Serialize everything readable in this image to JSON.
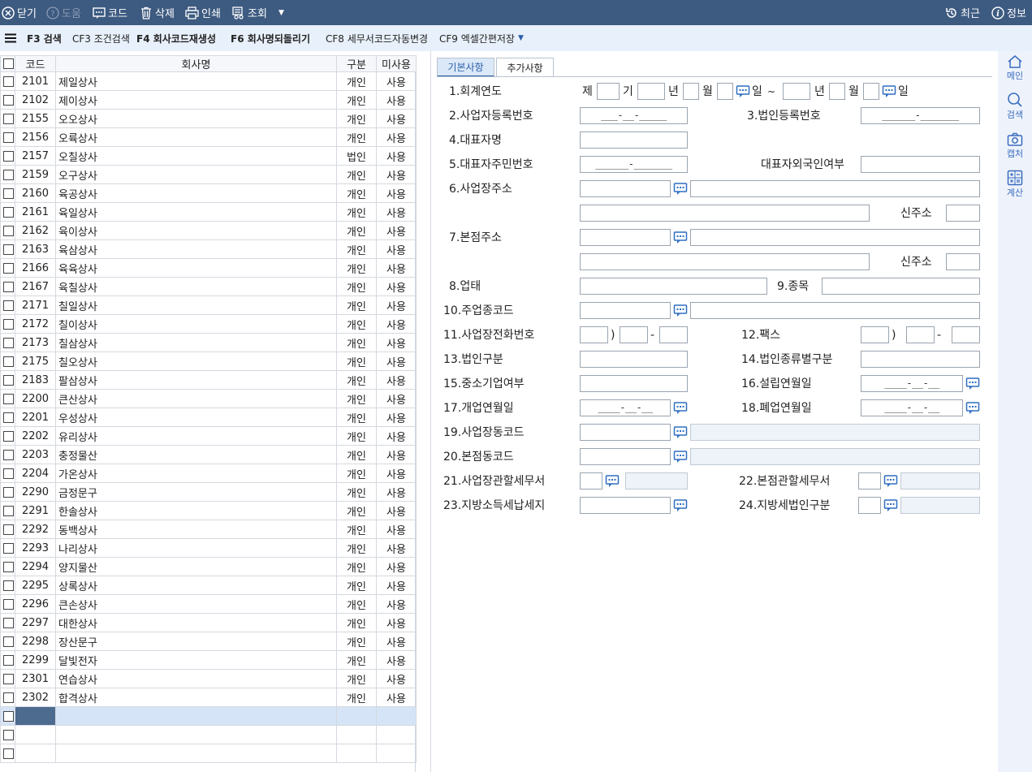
{
  "topbar": {
    "close_label": "닫기",
    "help_label": "도움",
    "code_label": "코드",
    "delete_label": "삭제",
    "print_label": "인쇄",
    "lookup_label": "조회",
    "recent_label": "최근",
    "info_label": "정보"
  },
  "fbar": {
    "f3": "F3 검색",
    "cf3": "CF3 조건검색",
    "f4": "F4 회사코드재생성",
    "f6": "F6 회사명되돌리기",
    "cf8": "CF8 세무서코드자동변경",
    "cf9": "CF9 엑셀간편저장"
  },
  "side": {
    "main": "메인",
    "search": "검색",
    "capture": "캡처",
    "calc": "계산"
  },
  "grid": {
    "headers": [
      "코드",
      "회사명",
      "구분",
      "미사용"
    ],
    "rows": [
      [
        "2101",
        "제일상사",
        "개인",
        "사용"
      ],
      [
        "2102",
        "제이상사",
        "개인",
        "사용"
      ],
      [
        "2155",
        "오오상사",
        "개인",
        "사용"
      ],
      [
        "2156",
        "오륙상사",
        "개인",
        "사용"
      ],
      [
        "2157",
        "오칠상사",
        "법인",
        "사용"
      ],
      [
        "2159",
        "오구상사",
        "개인",
        "사용"
      ],
      [
        "2160",
        "육공상사",
        "개인",
        "사용"
      ],
      [
        "2161",
        "육일상사",
        "개인",
        "사용"
      ],
      [
        "2162",
        "육이상사",
        "개인",
        "사용"
      ],
      [
        "2163",
        "육삼상사",
        "개인",
        "사용"
      ],
      [
        "2166",
        "육육상사",
        "개인",
        "사용"
      ],
      [
        "2167",
        "육칠상사",
        "개인",
        "사용"
      ],
      [
        "2171",
        "칠일상사",
        "개인",
        "사용"
      ],
      [
        "2172",
        "칠이상사",
        "개인",
        "사용"
      ],
      [
        "2173",
        "칠삼상사",
        "개인",
        "사용"
      ],
      [
        "2175",
        "칠오상사",
        "개인",
        "사용"
      ],
      [
        "2183",
        "팔삼상사",
        "개인",
        "사용"
      ],
      [
        "2200",
        "큰산상사",
        "개인",
        "사용"
      ],
      [
        "2201",
        "우성상사",
        "개인",
        "사용"
      ],
      [
        "2202",
        "유리상사",
        "개인",
        "사용"
      ],
      [
        "2203",
        "충정물산",
        "개인",
        "사용"
      ],
      [
        "2204",
        "가온상사",
        "개인",
        "사용"
      ],
      [
        "2290",
        "금정문구",
        "개인",
        "사용"
      ],
      [
        "2291",
        "한솔상사",
        "개인",
        "사용"
      ],
      [
        "2292",
        "동백상사",
        "개인",
        "사용"
      ],
      [
        "2293",
        "나리상사",
        "개인",
        "사용"
      ],
      [
        "2294",
        "양지물산",
        "개인",
        "사용"
      ],
      [
        "2295",
        "상록상사",
        "개인",
        "사용"
      ],
      [
        "2296",
        "큰손상사",
        "개인",
        "사용"
      ],
      [
        "2297",
        "대한상사",
        "개인",
        "사용"
      ],
      [
        "2298",
        "장산문구",
        "개인",
        "사용"
      ],
      [
        "2299",
        "달빛전자",
        "개인",
        "사용"
      ],
      [
        "2301",
        "연습상사",
        "개인",
        "사용"
      ],
      [
        "2302",
        "합격상사",
        "개인",
        "사용"
      ]
    ]
  },
  "tabs": [
    "기본사항",
    "추가사항"
  ],
  "form": {
    "f1": "1.회계연도",
    "f1_je": "제",
    "f1_gi": "기",
    "f1_year": "년",
    "f1_month": "월",
    "f1_day": "일",
    "f1_tilde": "~",
    "f2": "2.사업자등록번호",
    "f2_mask": "___-__-_____",
    "f3": "3.법인등록번호",
    "f3_mask": "______-_______",
    "f4": "4.대표자명",
    "f5": "5.대표자주민번호",
    "f5_mask": "______-_______",
    "f5b": "대표자외국인여부",
    "f6": "6.사업장주소",
    "f6_new": "신주소",
    "f7": "7.본점주소",
    "f7_new": "신주소",
    "f8": "8.업태",
    "f9": "9.종목",
    "f10": "10.주업종코드",
    "f11": "11.사업장전화번호",
    "f12": "12.팩스",
    "paren": ")",
    "dash": "-",
    "f13": "13.법인구분",
    "f14": "14.법인종류별구분",
    "f15": "15.중소기업여부",
    "f16": "16.설립연월일",
    "f16_mask": "____-__-__",
    "f17": "17.개업연월일",
    "f17_mask": "____-__-__",
    "f18": "18.폐업연월일",
    "f18_mask": "____-__-__",
    "f19": "19.사업장동코드",
    "f20": "20.본점동코드",
    "f21": "21.사업장관할세무서",
    "f22": "22.본점관할세무서",
    "f23": "23.지방소득세납세지",
    "f24": "24.지방세법인구분"
  }
}
